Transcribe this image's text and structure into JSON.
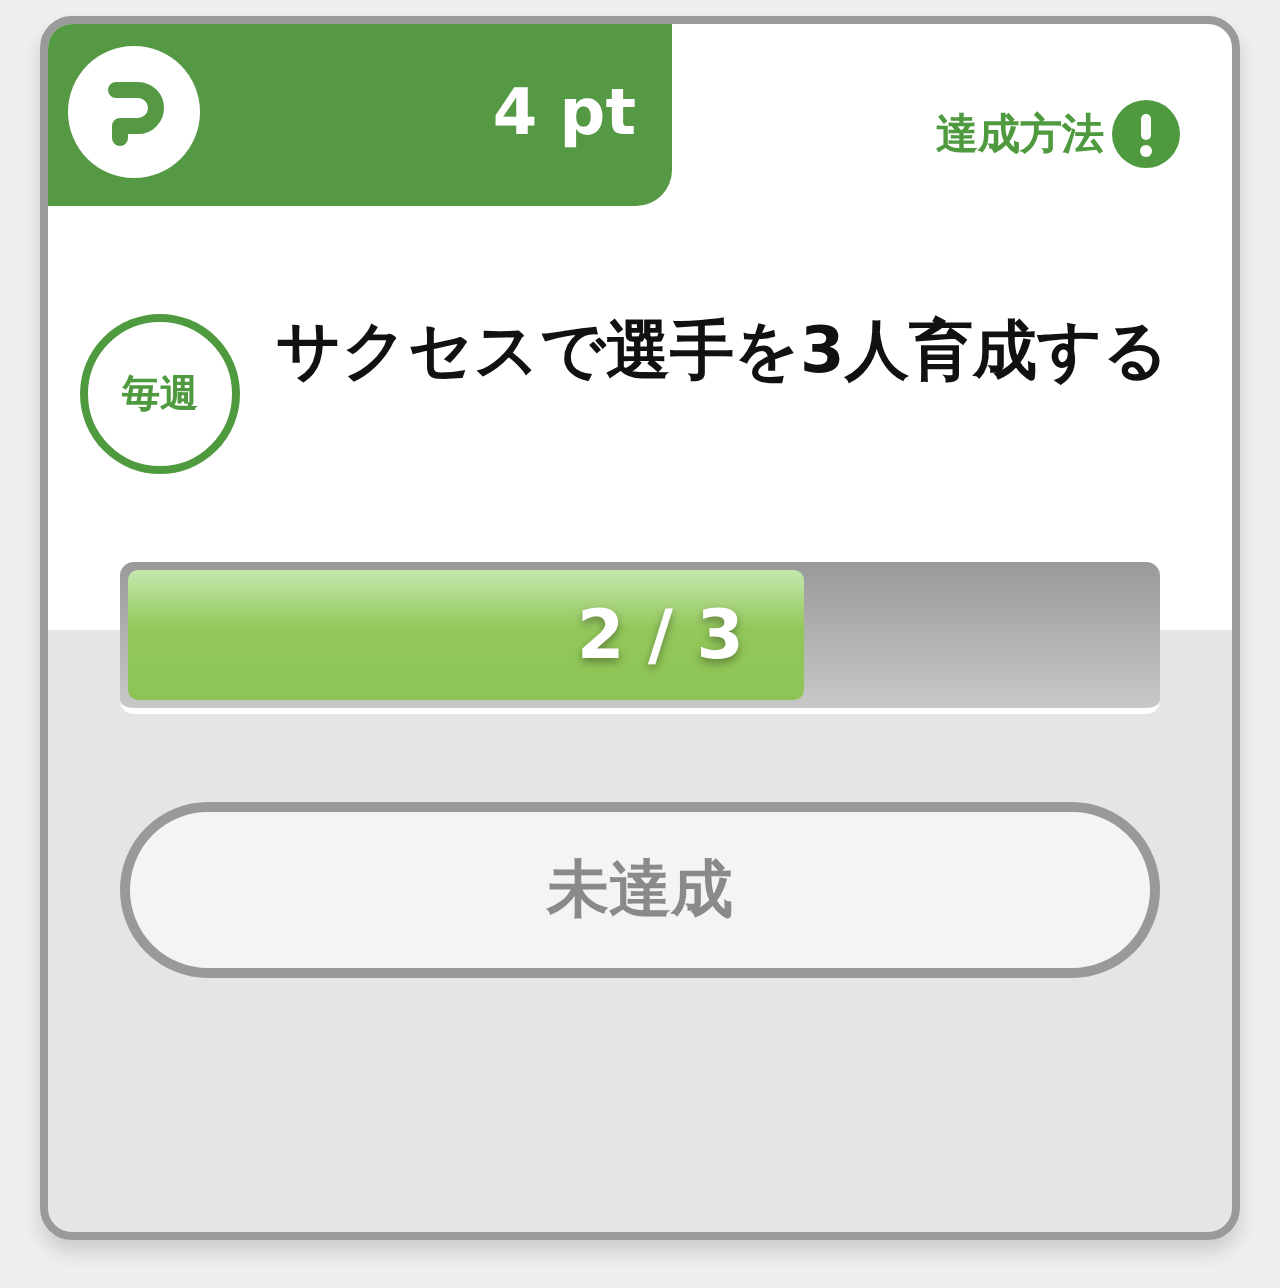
{
  "reward": {
    "points": "4 pt"
  },
  "how_to": {
    "label": "達成方法"
  },
  "mission": {
    "period": "毎週",
    "title": "サクセスで選手を3人育成する"
  },
  "progress": {
    "level": 0.66,
    "reading": "2 / 3"
  },
  "status": {
    "label": "未達成",
    "achieved": false
  }
}
